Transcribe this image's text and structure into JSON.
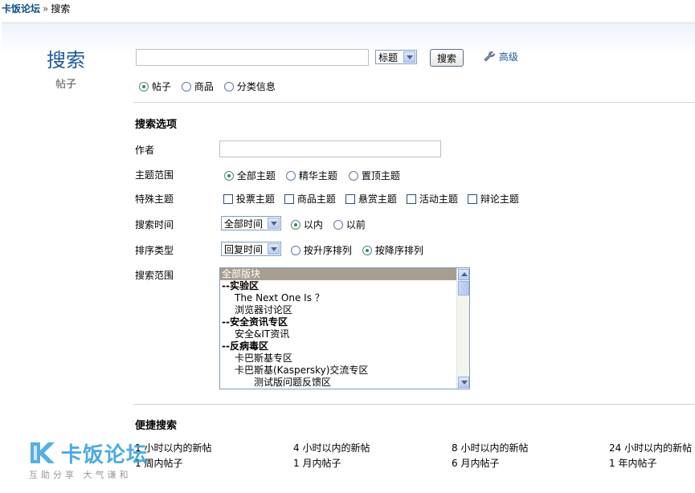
{
  "breadcrumb": {
    "home": "卡饭论坛",
    "separator": "»",
    "current": "搜索"
  },
  "brand": {
    "title": "搜索",
    "subtitle": "帖子"
  },
  "search": {
    "query": "",
    "scope_select": "标题",
    "submit": "搜索",
    "advanced": "高级"
  },
  "search_types": [
    {
      "label": "帖子",
      "selected": true
    },
    {
      "label": "商品",
      "selected": false
    },
    {
      "label": "分类信息",
      "selected": false
    }
  ],
  "options": {
    "heading": "搜索选项",
    "author_label": "作者",
    "author_value": "",
    "topic_scope_label": "主题范围",
    "topic_scope": [
      {
        "label": "全部主题",
        "selected": true
      },
      {
        "label": "精华主题",
        "selected": false
      },
      {
        "label": "置顶主题",
        "selected": false
      }
    ],
    "special_label": "特殊主题",
    "special": [
      {
        "label": "投票主题"
      },
      {
        "label": "商品主题"
      },
      {
        "label": "悬赏主题"
      },
      {
        "label": "活动主题"
      },
      {
        "label": "辩论主题"
      }
    ],
    "time_label": "搜索时间",
    "time_select": "全部时间",
    "time_within": "以内",
    "time_before": "以前",
    "sort_label": "排序类型",
    "sort_select": "回复时间",
    "sort_asc": "按升序排列",
    "sort_desc": "按降序排列",
    "range_label": "搜索范围",
    "forums": [
      {
        "label": "全部版块",
        "type": "selected"
      },
      {
        "label": "--实验区",
        "type": "cat"
      },
      {
        "label": "The Next One Is ？",
        "type": "l1"
      },
      {
        "label": "浏览器讨论区",
        "type": "l1"
      },
      {
        "label": "--安全资讯专区",
        "type": "cat"
      },
      {
        "label": "安全&IT资讯",
        "type": "l1"
      },
      {
        "label": "--反病毒区",
        "type": "cat"
      },
      {
        "label": "卡巴斯基专区",
        "type": "l1"
      },
      {
        "label": "卡巴斯基(Kaspersky)交流专区",
        "type": "l1"
      },
      {
        "label": "测试版问题反馈区",
        "type": "l2"
      }
    ]
  },
  "quick": {
    "heading": "便捷搜索",
    "links": [
      "1 小时以内的新帖",
      "4 小时以内的新帖",
      "8 小时以内的新帖",
      "24 小时以内的新帖",
      "1 周内帖子",
      "1 月内帖子",
      "6 月内帖子",
      "1 年内帖子"
    ]
  },
  "watermark": {
    "name": "卡饭论坛",
    "slogan": "互助分享  大气谦和",
    "color": "#3aa1de"
  }
}
